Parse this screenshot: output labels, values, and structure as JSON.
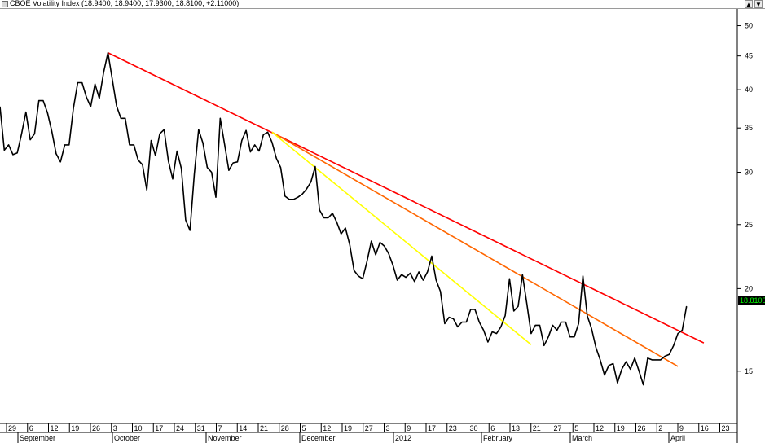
{
  "window": {
    "title": "CBOE Volatility Index (18.9400, 18.9400, 17.9300, 18.8100, +2.11000)",
    "controls": [
      "▲",
      "▼"
    ]
  },
  "price_label": "18.8100",
  "colors": {
    "price": "#000000",
    "trend_red": "#ff0000",
    "trend_orange": "#ff6600",
    "trend_yellow": "#ffff00",
    "price_label_bg": "#000000",
    "price_label_fg": "#00ff00"
  },
  "chart_data": {
    "type": "line",
    "title": "CBOE Volatility Index",
    "y_scale": "log",
    "ylim": [
      12.5,
      53
    ],
    "y_ticks": [
      50,
      45,
      40,
      35,
      30,
      25,
      20,
      15
    ],
    "x_tick_labels": [
      "29",
      "6",
      "12",
      "19",
      "26",
      "3",
      "10",
      "17",
      "24",
      "31",
      "7",
      "14",
      "21",
      "28",
      "5",
      "12",
      "19",
      "27",
      "3",
      "9",
      "17",
      "23",
      "30",
      "6",
      "13",
      "21",
      "27",
      "5",
      "12",
      "19",
      "26",
      "2",
      "9",
      "16",
      "23"
    ],
    "month_labels": [
      "September",
      "October",
      "November",
      "December",
      "2012",
      "February",
      "March",
      "April"
    ],
    "series": [
      {
        "values": [
          37.7,
          32.4,
          33.0,
          31.9,
          32.1,
          34.3,
          37.0,
          33.6,
          34.3,
          38.5,
          38.5,
          36.9,
          34.6,
          32.0,
          31.1,
          33.0,
          33.0,
          37.5,
          41.0,
          41.0,
          39.0,
          37.7,
          40.8,
          38.8,
          42.5,
          45.5,
          41.5,
          37.8,
          36.2,
          36.2,
          33.0,
          33.0,
          31.3,
          30.8,
          28.2,
          33.5,
          31.8,
          34.3,
          34.8,
          31.2,
          29.3,
          32.3,
          30.4,
          25.4,
          24.5,
          29.8,
          34.8,
          33.2,
          30.5,
          30.0,
          27.5,
          36.2,
          33.1,
          30.2,
          31.0,
          31.1,
          33.5,
          34.7,
          32.2,
          33.0,
          32.3,
          34.2,
          34.5,
          33.3,
          31.5,
          30.5,
          27.6,
          27.3,
          27.3,
          27.5,
          27.8,
          28.3,
          29.0,
          30.6,
          26.3,
          25.6,
          25.6,
          26.0,
          25.2,
          24.2,
          24.7,
          23.3,
          21.3,
          20.9,
          20.7,
          22.0,
          23.6,
          22.5,
          23.5,
          23.2,
          22.6,
          21.7,
          20.6,
          21.0,
          20.8,
          21.1,
          20.5,
          21.2,
          20.6,
          21.2,
          22.4,
          20.6,
          19.8,
          17.7,
          18.1,
          18.0,
          17.5,
          17.8,
          17.8,
          18.6,
          18.6,
          17.8,
          17.3,
          16.6,
          17.2,
          17.1,
          17.5,
          18.2,
          20.7,
          18.5,
          18.8,
          21.0,
          19.0,
          17.1,
          17.6,
          17.6,
          16.4,
          16.9,
          17.6,
          17.3,
          17.8,
          17.8,
          16.9,
          16.9,
          17.7,
          20.9,
          18.2,
          17.4,
          16.3,
          15.6,
          14.8,
          15.3,
          15.4,
          14.4,
          15.1,
          15.5,
          15.1,
          15.7,
          15.0,
          14.3,
          15.7,
          15.6,
          15.6,
          15.6,
          15.8,
          15.9,
          16.4,
          17.1,
          17.3,
          18.8
        ]
      }
    ],
    "trendlines": [
      {
        "color": "red",
        "start": [
          25,
          45.5
        ],
        "end": [
          163,
          16.55
        ]
      },
      {
        "color": "orange",
        "start": [
          63,
          34.5
        ],
        "end": [
          157,
          15.25
        ]
      },
      {
        "color": "yellow",
        "start": [
          63,
          34.5
        ],
        "end": [
          123,
          16.45
        ]
      }
    ]
  }
}
